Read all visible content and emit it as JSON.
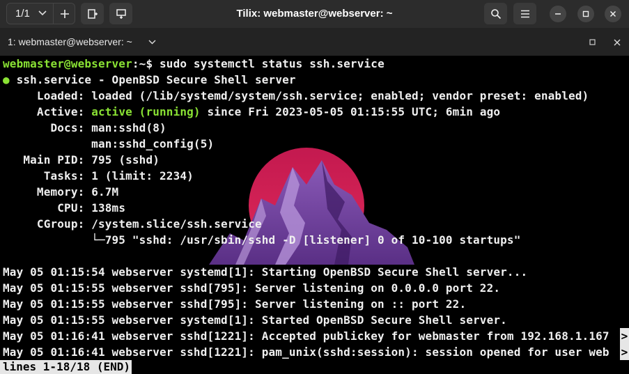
{
  "window": {
    "title": "Tilix: webmaster@webserver: ~",
    "session_indicator": "1/1"
  },
  "tab": {
    "label": "1: webmaster@webserver: ~"
  },
  "terminal": {
    "prompt_user_host": "webmaster@webserver",
    "prompt_path": ":~$",
    "command": " sudo systemctl status ssh.service",
    "unit_bullet": "●",
    "unit_title": " ssh.service - OpenBSD Secure Shell server",
    "loaded_key": "     Loaded:",
    "loaded_val": " loaded (/lib/systemd/system/ssh.service; enabled; vendor preset: enabled)",
    "active_key": "     Active:",
    "active_state": " active (running)",
    "active_since": " since Fri 2023-05-05 01:15:55 UTC; 6min ago",
    "docs_key": "       Docs:",
    "docs_val1": " man:sshd(8)",
    "docs_val2": "             man:sshd_config(5)",
    "pid_key": "   Main PID:",
    "pid_val": " 795 (sshd)",
    "tasks_key": "      Tasks:",
    "tasks_val": " 1 (limit: 2234)",
    "memory_key": "     Memory:",
    "memory_val": " 6.7M",
    "cpu_key": "        CPU:",
    "cpu_val": " 138ms",
    "cgroup_key": "     CGroup:",
    "cgroup_val": " /system.slice/ssh.service",
    "cgroup_child": "             └─795 \"sshd: /usr/sbin/sshd -D [listener] 0 of 10-100 startups\"",
    "log_lines": [
      "May 05 01:15:54 webserver systemd[1]: Starting OpenBSD Secure Shell server...",
      "May 05 01:15:55 webserver sshd[795]: Server listening on 0.0.0.0 port 22.",
      "May 05 01:15:55 webserver sshd[795]: Server listening on :: port 22.",
      "May 05 01:15:55 webserver systemd[1]: Started OpenBSD Secure Shell server.",
      "May 05 01:16:41 webserver sshd[1221]: Accepted publickey for webmaster from 192.168.1.167",
      "May 05 01:16:41 webserver sshd[1221]: pam_unix(sshd:session): session opened for user web"
    ],
    "overflow_marker": ">",
    "pager_status": "lines 1-18/18 (END)"
  },
  "icons": {
    "session_dropdown": "chevron-down-icon",
    "add_session": "plus-icon",
    "split_right": "split-right-icon",
    "split_down": "split-down-icon",
    "search": "search-icon",
    "menu": "hamburger-menu-icon",
    "minimize": "minimize-icon",
    "maximize": "maximize-icon",
    "close": "close-icon",
    "tab_dropdown": "chevron-down-icon",
    "tab_maximize": "maximize-icon",
    "tab_close": "close-icon"
  },
  "colors": {
    "prompt_green": "#8ae234",
    "text": "#f0f0f0",
    "background": "#000000",
    "titlebar": "#2c2c2c"
  }
}
